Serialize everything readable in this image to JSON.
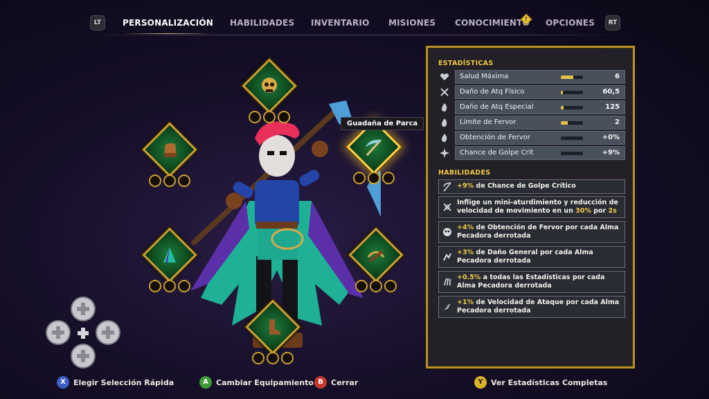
{
  "nav": {
    "left_trigger": "LT",
    "right_trigger": "RT",
    "tabs": [
      {
        "label": "PERSONALIZACIÓN",
        "active": true
      },
      {
        "label": "HABILIDADES",
        "active": false
      },
      {
        "label": "INVENTARIO",
        "active": false
      },
      {
        "label": "MISIONES",
        "active": false
      },
      {
        "label": "CONOCIMIENTO",
        "active": false,
        "badge": "!"
      },
      {
        "label": "OPCIONES",
        "active": false
      }
    ]
  },
  "equipment": {
    "tooltip": "Guadaña de Parca",
    "slots": [
      {
        "name": "head",
        "icon": "skull-mask-icon",
        "selected": false
      },
      {
        "name": "hands",
        "icon": "glove-icon",
        "selected": false
      },
      {
        "name": "weapon",
        "icon": "scythe-icon",
        "selected": true
      },
      {
        "name": "body",
        "icon": "cloak-icon",
        "selected": false
      },
      {
        "name": "ranged",
        "icon": "crossbow-icon",
        "selected": false
      },
      {
        "name": "feet",
        "icon": "boot-icon",
        "selected": false
      }
    ]
  },
  "stats": {
    "title": "ESTADÍSTICAS",
    "rows": [
      {
        "icon": "heart-icon",
        "label": "Salud Máxima",
        "value": "6",
        "fill": 0.55
      },
      {
        "icon": "crossed-swords-icon",
        "label": "Daño de Atq Físico",
        "value": "60,5",
        "fill": 0.08
      },
      {
        "icon": "flame-icon",
        "label": "Daño de Atq Especial",
        "value": "125",
        "fill": 0.12
      },
      {
        "icon": "flame-icon",
        "label": "Límite de Fervor",
        "value": "2",
        "fill": 0.3
      },
      {
        "icon": "flame-icon",
        "label": "Obtención de Fervor",
        "value": "+0%",
        "fill": 0
      },
      {
        "icon": "burst-icon",
        "label": "Chance de Golpe Crít",
        "value": "+9%",
        "fill": 0
      }
    ]
  },
  "abilities": {
    "title": "HABILIDADES",
    "items": [
      {
        "icon": "scythe-icon",
        "highlight": "+9%",
        "text": " de Chance de Golpe Crítico"
      },
      {
        "icon": "stun-icon",
        "pre": "Inflige un mini-aturdimiento y reducción de velocidad de movimiento en un ",
        "highlight": "30%",
        "mid": " por ",
        "highlight2": "2s"
      },
      {
        "icon": "mask-icon",
        "highlight": "+4%",
        "text": " de Obtención de Fervor por cada Alma Pecadora derrotada"
      },
      {
        "icon": "damage-icon",
        "highlight": "+3%",
        "text": " de Daño General por cada Alma Pecadora derrotada"
      },
      {
        "icon": "claw-icon",
        "highlight": "+0.5%",
        "text": " a todas las Estadísticas por cada Alma Pecadora derrotada"
      },
      {
        "icon": "speed-icon",
        "highlight": "+1%",
        "text": " de Velocidad de Ataque por cada Alma Pecadora derrotada"
      }
    ]
  },
  "prompts": [
    {
      "button": "X",
      "label": "Elegir Selección Rápida",
      "color": "#3b5fc4"
    },
    {
      "button": "A",
      "label": "Cambiar Equipamiento",
      "color": "#3f9b3a"
    },
    {
      "button": "B",
      "label": "Cerrar",
      "color": "#c4382f"
    },
    {
      "button": "Y",
      "label": "Ver Estadísticas Completas",
      "color": "#d9b42a"
    }
  ],
  "colors": {
    "accent_gold": "#b78f2c",
    "highlight": "#f2c94c",
    "slot_green": "#1f7a3a"
  }
}
